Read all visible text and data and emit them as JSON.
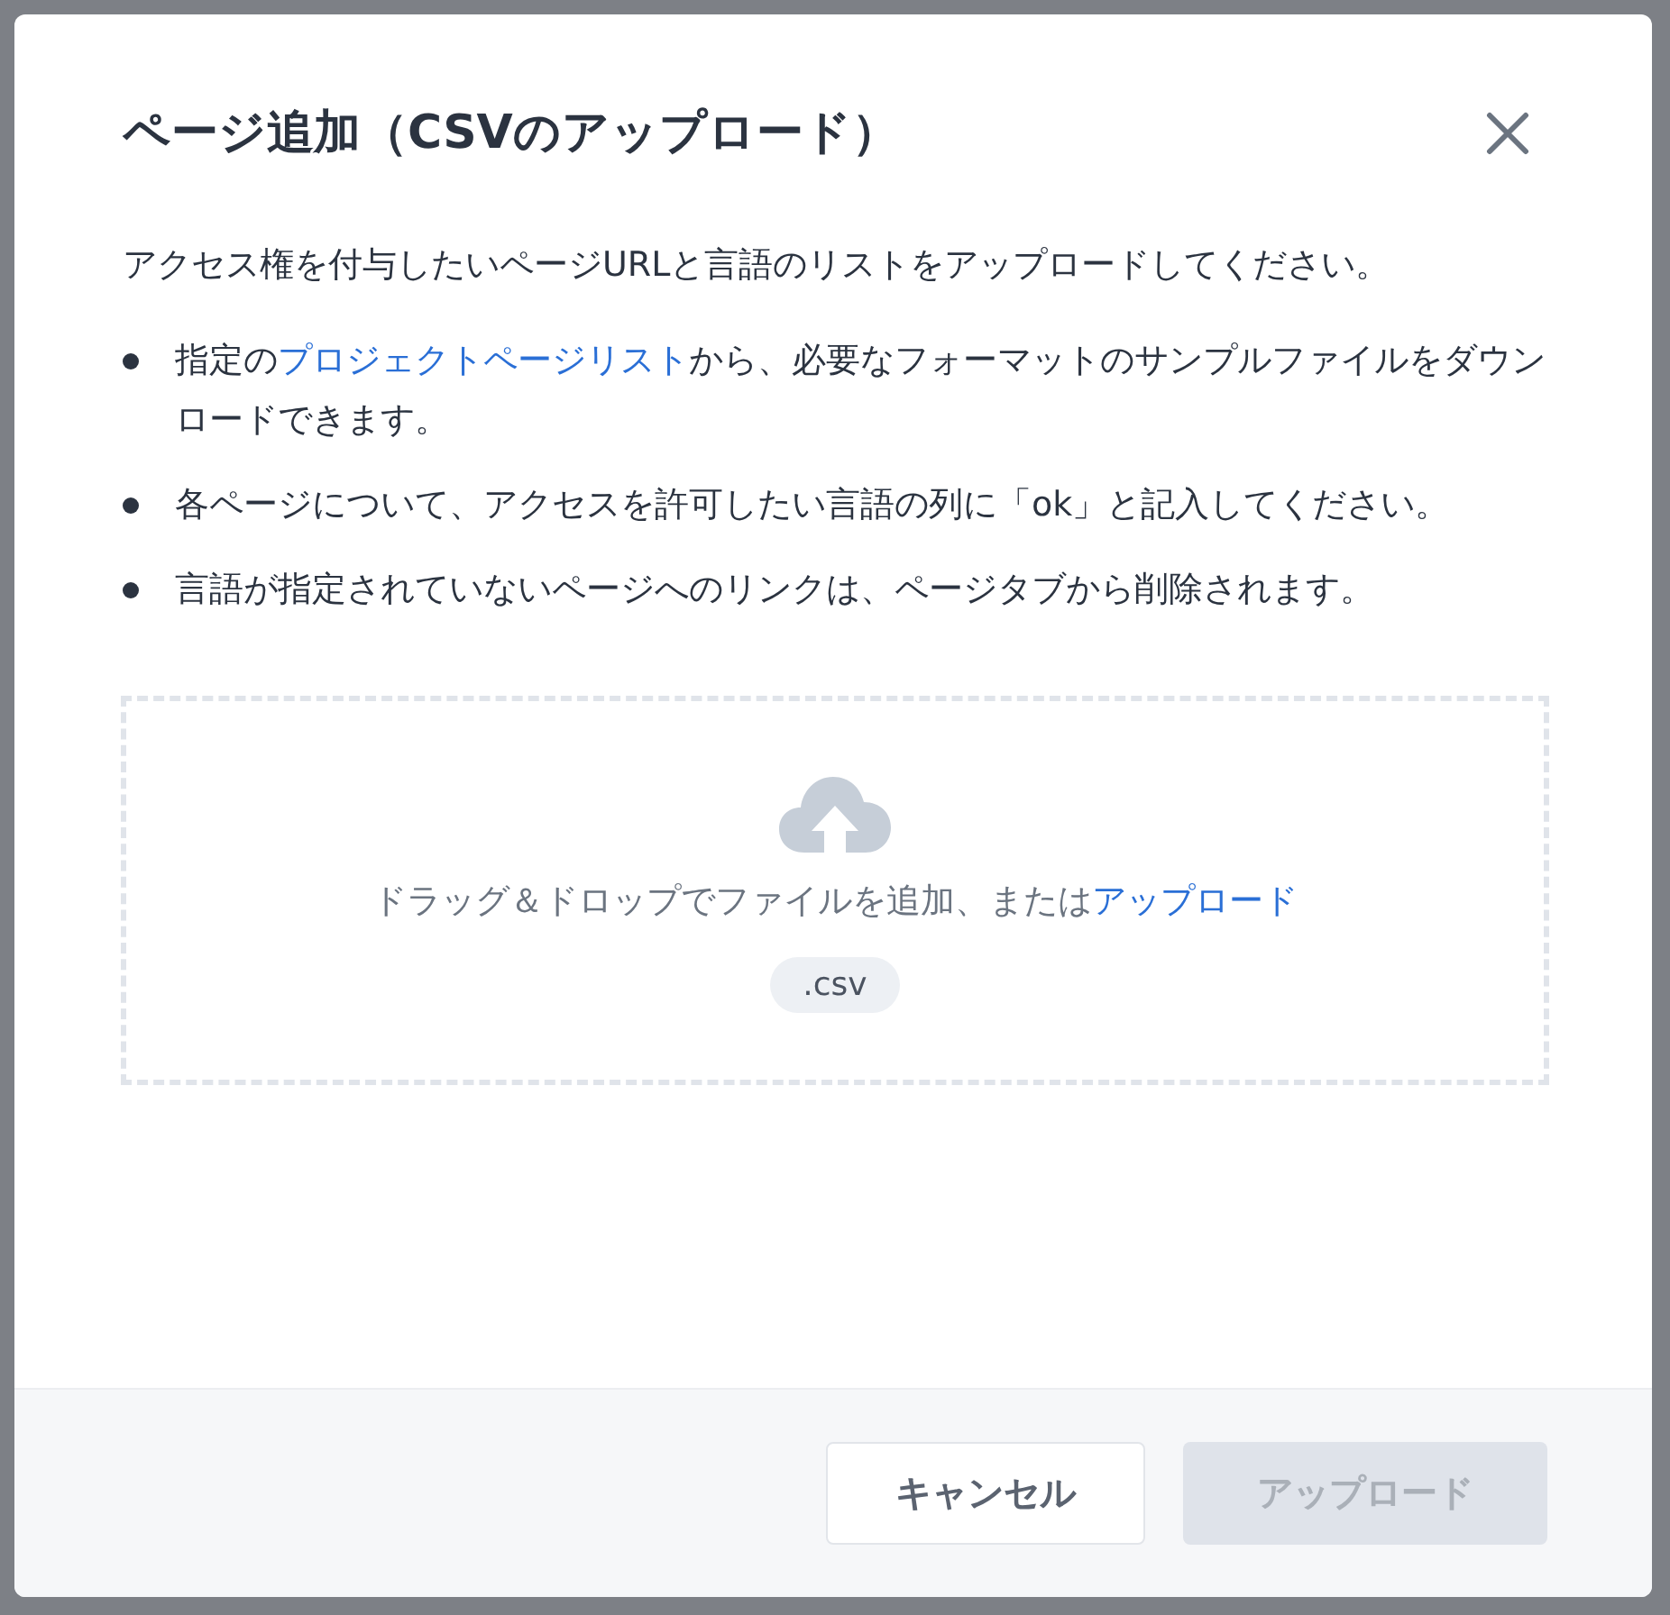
{
  "dialog": {
    "title": "ページ追加（CSVのアップロード）",
    "intro": "アクセス権を付与したいページURLと言語のリストをアップロードしてください。",
    "bullets": [
      {
        "segments": [
          {
            "kind": "text",
            "text": "指定の"
          },
          {
            "kind": "link",
            "text": "プロジェクトページリスト"
          },
          {
            "kind": "text",
            "text": "から、必要なフォーマットのサンプルファイルをダウンロードできます。"
          }
        ]
      },
      {
        "segments": [
          {
            "kind": "text",
            "text": "各ページについて、アクセスを許可したい言語の列に「ok」と記入してください。"
          }
        ]
      },
      {
        "segments": [
          {
            "kind": "text",
            "text": "言語が指定されていないページへのリンクは、ページタブから削除されます。"
          }
        ]
      }
    ],
    "dropzone": {
      "segments": [
        {
          "kind": "text",
          "text": "ドラッグ＆ドロップでファイルを追加、または"
        },
        {
          "kind": "link",
          "text": "アップロード"
        }
      ],
      "file_type": ".csv"
    },
    "buttons": [
      {
        "kind": "secondary",
        "label": "キャンセル",
        "disabled": false
      },
      {
        "kind": "primary",
        "label": "アップロード",
        "disabled": true
      }
    ]
  }
}
